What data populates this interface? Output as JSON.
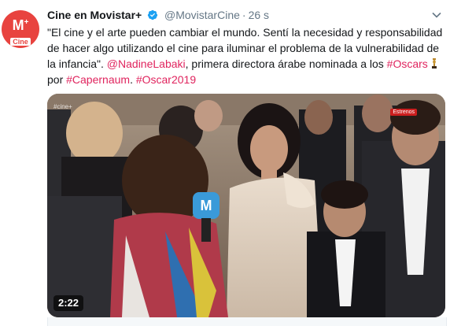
{
  "account": {
    "name": "Cine en Movistar+",
    "handle": "@MovistarCine",
    "separator": "·",
    "time": "26 s",
    "avatar_mark": "M",
    "avatar_plus": "+",
    "avatar_sub": "Cine"
  },
  "tweet": {
    "quote": "\"El cine y el arte pueden cambiar el mundo. Sentí la necesidad y responsabilidad de hacer algo utilizando el cine para iluminar el problema de la vulnerabilidad de la infancia\". ",
    "mention": "@NadineLabaki",
    "text_after_mention": ", primera directora árabe nominada a los ",
    "hashtag_oscars": "#Oscars",
    "text_por": "por ",
    "hashtag_capernaum": "#Capernaum",
    "text_period": ". ",
    "hashtag_oscar2019": "#Oscar2019"
  },
  "video": {
    "duration": "2:22",
    "channel_mark": "M",
    "tag_label": "Estrenos",
    "corner_text": "#cine+"
  },
  "colors": {
    "brand": "#e8433f",
    "link": "#e0245e",
    "verified": "#1da1f2",
    "muted": "#657786"
  }
}
